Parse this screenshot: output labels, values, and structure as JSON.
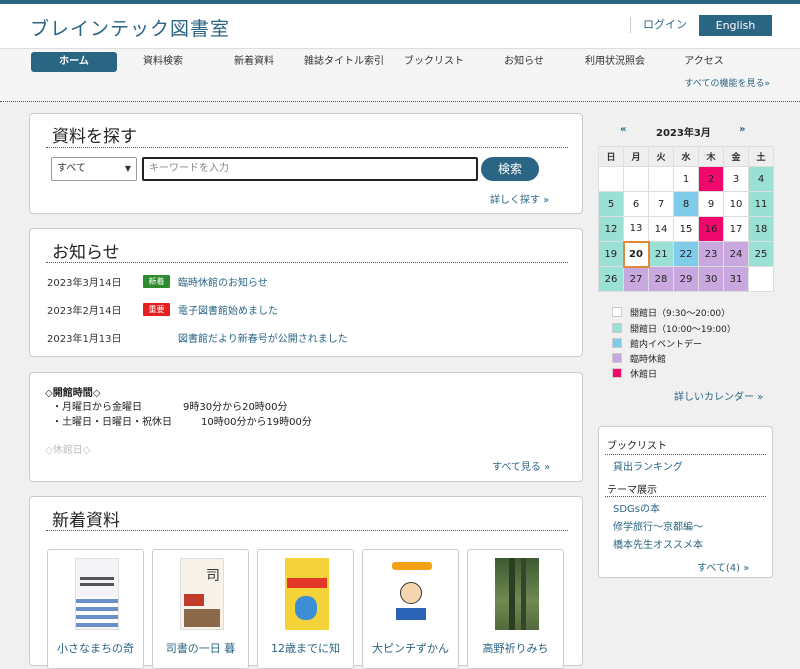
{
  "header": {
    "site_title": "ブレインテック図書室",
    "login": "ログイン",
    "english": "English"
  },
  "nav": {
    "items": [
      "ホーム",
      "資料検索",
      "新着資料",
      "雑誌タイトル索引",
      "ブックリスト",
      "お知らせ",
      "利用状況照会",
      "アクセス"
    ],
    "all_features": "すべての機能を見る»"
  },
  "search": {
    "title": "資料を探す",
    "select_value": "すべて",
    "placeholder": "キーワードを入力",
    "button": "検索",
    "advanced": "詳しく探す »"
  },
  "news": {
    "title": "お知らせ",
    "items": [
      {
        "date": "2023年3月14日",
        "badge": "新着",
        "badge_color": "#2e8b2e",
        "title": "臨時休館のお知らせ"
      },
      {
        "date": "2023年2月14日",
        "badge": "重要",
        "badge_color": "#e52020",
        "title": "電子図書館始めました"
      },
      {
        "date": "2023年1月13日",
        "badge": "",
        "badge_color": "",
        "title": "図書館だより新春号が公開されました"
      }
    ]
  },
  "hours": {
    "heading": "◇開館時間◇",
    "line1_days": "・月曜日から金曜日",
    "line1_time": "9時30分から20時00分",
    "line2_days": "・土曜日・日曜日・祝休日",
    "line2_time": "10時00分から19時00分",
    "closed": "◇休館日◇",
    "see_all": "すべて見る »"
  },
  "new_items": {
    "title": "新着資料",
    "books": [
      "小さなまちの奇",
      "司書の一日 暮",
      "12歳までに知",
      "大ピンチずかん",
      "高野祈りみち"
    ]
  },
  "calendar": {
    "prev": "«",
    "next": "»",
    "month": "2023年3月",
    "weekdays": [
      "日",
      "月",
      "火",
      "水",
      "木",
      "金",
      "土"
    ],
    "rows": [
      [
        "",
        "",
        "",
        "1",
        "2",
        "3",
        "4"
      ],
      [
        "5",
        "6",
        "7",
        "8",
        "9",
        "10",
        "11"
      ],
      [
        "12",
        "13",
        "14",
        "15",
        "16",
        "17",
        "18"
      ],
      [
        "19",
        "20",
        "21",
        "22",
        "23",
        "24",
        "25"
      ],
      [
        "26",
        "27",
        "28",
        "29",
        "30",
        "31",
        ""
      ]
    ],
    "colors": {
      "open": "#ffffff",
      "open_weekend": "#9be0d4",
      "event": "#7ecbea",
      "temp_closed": "#c9a8e0",
      "closed": "#f0086c"
    },
    "legend": [
      "開館日（9:30〜20:00）",
      "開館日（10:00〜19:00）",
      "館内イベントデー",
      "臨時休館",
      "休館日"
    ],
    "detail_link": "詳しいカレンダー »"
  },
  "side": {
    "booklist_title": "ブックリスト",
    "booklist_items": [
      "貸出ランキング"
    ],
    "theme_title": "テーマ展示",
    "theme_items": [
      "SDGsの本",
      "修学旅行〜京都編〜",
      "橋本先生オススメ本"
    ],
    "all_link": "すべて(4) »"
  }
}
